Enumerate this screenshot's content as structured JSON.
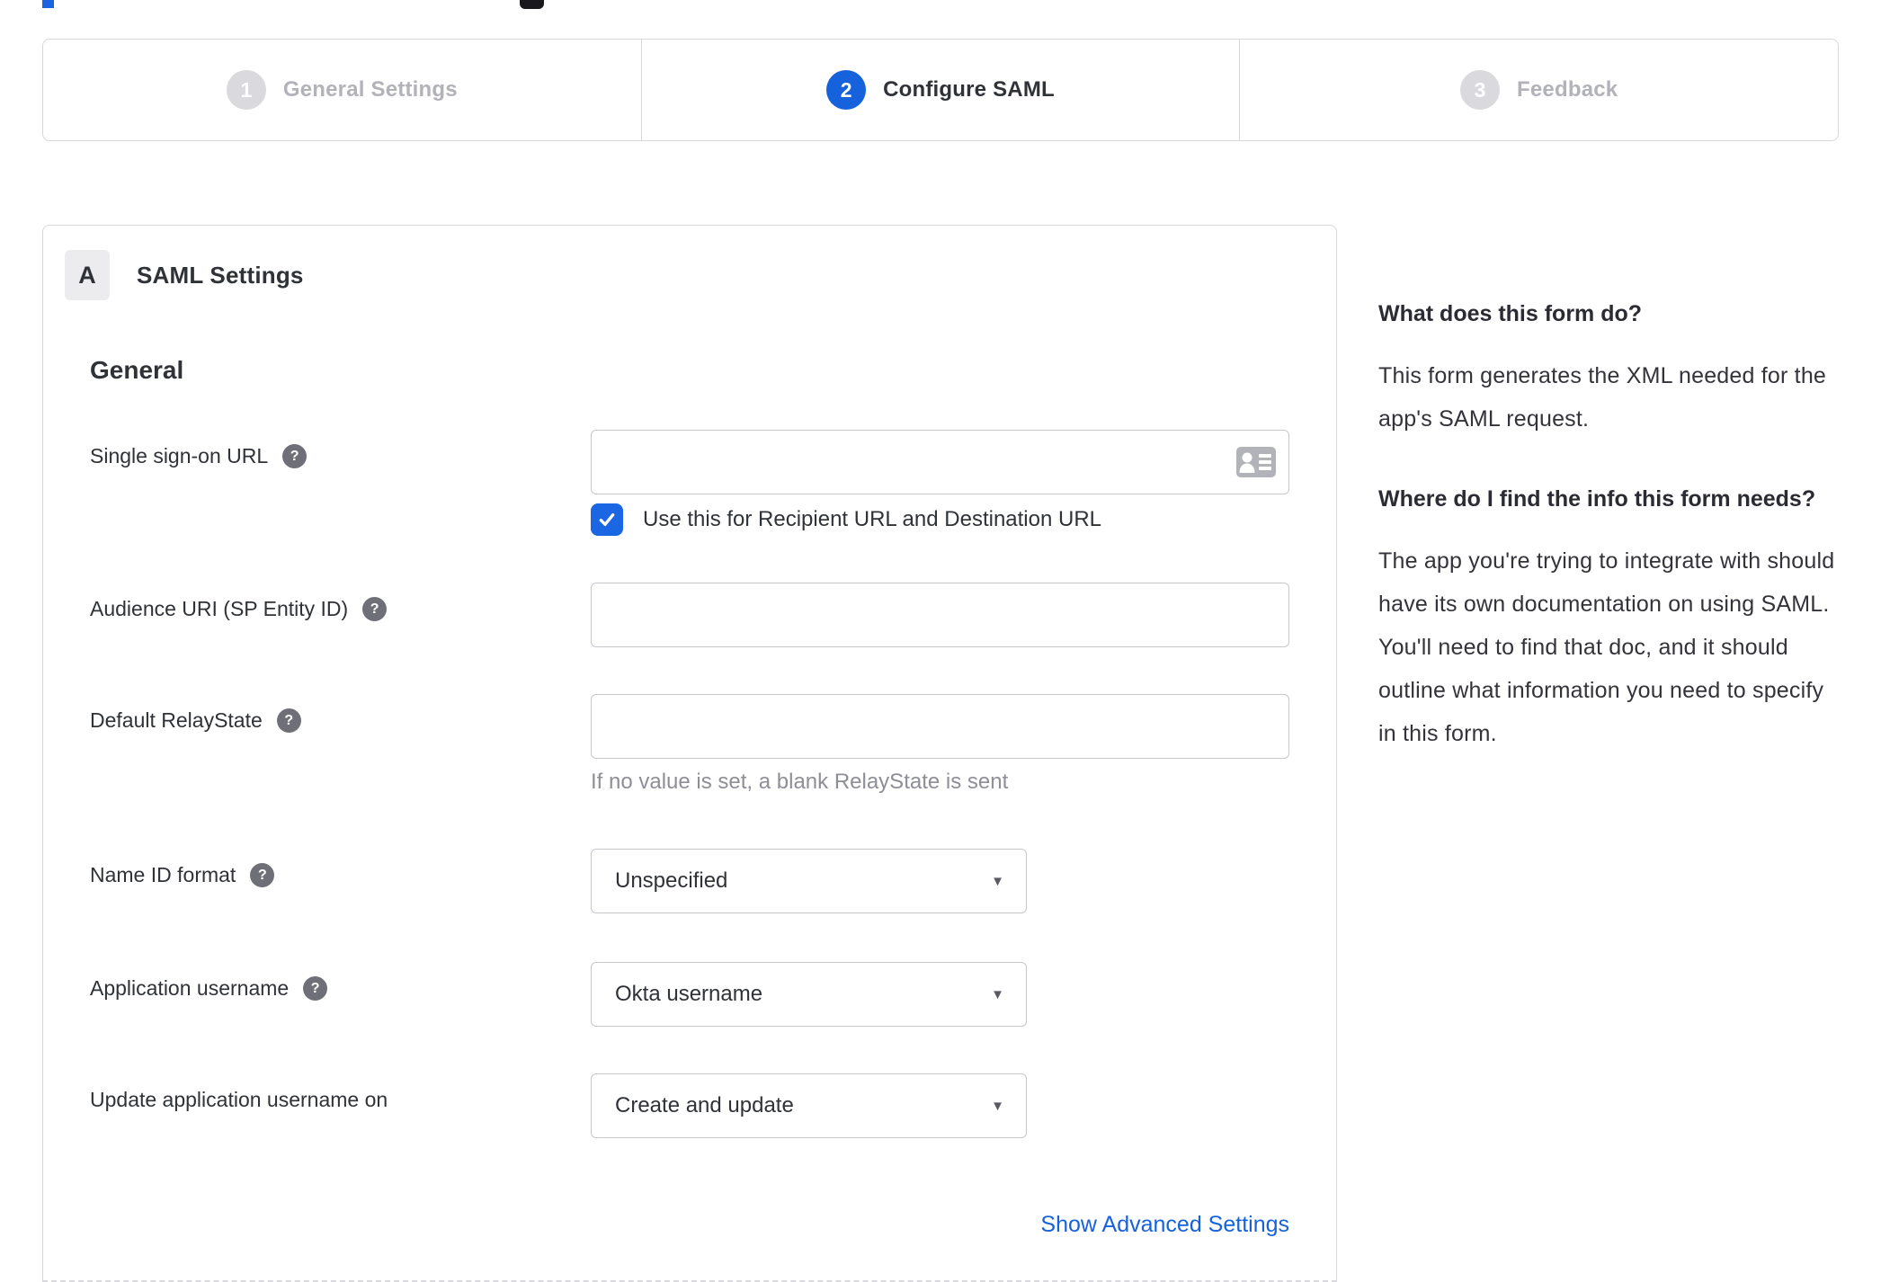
{
  "stepper": {
    "steps": [
      {
        "number": "1",
        "label": "General Settings",
        "active": false
      },
      {
        "number": "2",
        "label": "Configure SAML",
        "active": true
      },
      {
        "number": "3",
        "label": "Feedback",
        "active": false
      }
    ]
  },
  "form_card": {
    "section_badge": "A",
    "section_title": "SAML Settings",
    "group_heading": "General",
    "fields": {
      "sso_url": {
        "label": "Single sign-on URL",
        "value": "",
        "help_icon": "question-mark",
        "trailing_icon": "contact-card",
        "checkbox": {
          "checked": true,
          "label": "Use this for Recipient URL and Destination URL"
        }
      },
      "audience_uri": {
        "label": "Audience URI (SP Entity ID)",
        "value": "",
        "help_icon": "question-mark"
      },
      "default_relaystate": {
        "label": "Default RelayState",
        "value": "",
        "help_icon": "question-mark",
        "hint": "If no value is set, a blank RelayState is sent"
      },
      "name_id_format": {
        "label": "Name ID format",
        "value": "Unspecified",
        "help_icon": "question-mark"
      },
      "application_username": {
        "label": "Application username",
        "value": "Okta username",
        "help_icon": "question-mark"
      },
      "update_app_username_on": {
        "label": "Update application username on",
        "value": "Create and update"
      }
    },
    "advanced_link": "Show Advanced Settings"
  },
  "sidebar": {
    "sections": [
      {
        "heading": "What does this form do?",
        "body": "This form generates the XML needed for the app's SAML request."
      },
      {
        "heading": "Where do I find the info this form needs?",
        "body": "The app you're trying to integrate with should have its own documentation on using SAML. You'll need to find that doc, and it should outline what information you need to specify in this form."
      }
    ]
  },
  "colors": {
    "accent_blue": "#1662dd",
    "checkbox_blue": "#1b66e3",
    "link_blue": "#1662dd",
    "border_gray": "#d7d7dc",
    "inactive_step_gray": "#d9d9de",
    "hint_gray": "#8e8e97"
  }
}
